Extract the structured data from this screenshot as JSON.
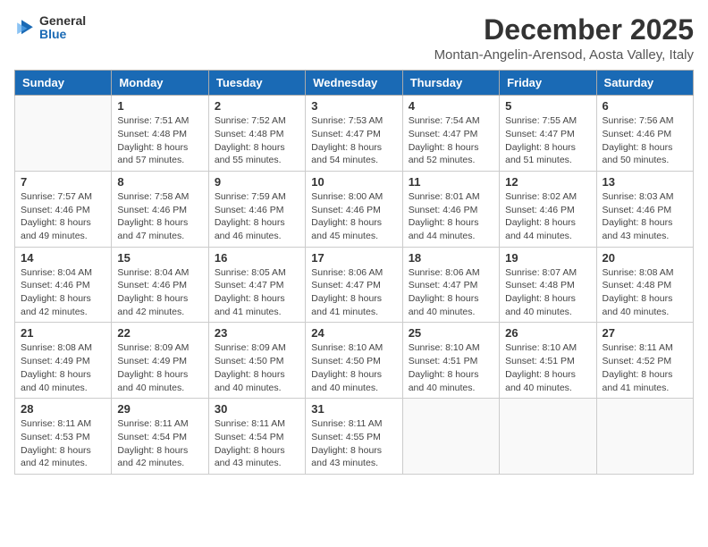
{
  "header": {
    "logo_general": "General",
    "logo_blue": "Blue",
    "month_title": "December 2025",
    "location": "Montan-Angelin-Arensod, Aosta Valley, Italy"
  },
  "days_of_week": [
    "Sunday",
    "Monday",
    "Tuesday",
    "Wednesday",
    "Thursday",
    "Friday",
    "Saturday"
  ],
  "weeks": [
    [
      {
        "day": "",
        "sunrise": "",
        "sunset": "",
        "daylight": ""
      },
      {
        "day": "1",
        "sunrise": "7:51 AM",
        "sunset": "4:48 PM",
        "daylight": "8 hours and 57 minutes."
      },
      {
        "day": "2",
        "sunrise": "7:52 AM",
        "sunset": "4:48 PM",
        "daylight": "8 hours and 55 minutes."
      },
      {
        "day": "3",
        "sunrise": "7:53 AM",
        "sunset": "4:47 PM",
        "daylight": "8 hours and 54 minutes."
      },
      {
        "day": "4",
        "sunrise": "7:54 AM",
        "sunset": "4:47 PM",
        "daylight": "8 hours and 52 minutes."
      },
      {
        "day": "5",
        "sunrise": "7:55 AM",
        "sunset": "4:47 PM",
        "daylight": "8 hours and 51 minutes."
      },
      {
        "day": "6",
        "sunrise": "7:56 AM",
        "sunset": "4:46 PM",
        "daylight": "8 hours and 50 minutes."
      }
    ],
    [
      {
        "day": "7",
        "sunrise": "7:57 AM",
        "sunset": "4:46 PM",
        "daylight": "8 hours and 49 minutes."
      },
      {
        "day": "8",
        "sunrise": "7:58 AM",
        "sunset": "4:46 PM",
        "daylight": "8 hours and 47 minutes."
      },
      {
        "day": "9",
        "sunrise": "7:59 AM",
        "sunset": "4:46 PM",
        "daylight": "8 hours and 46 minutes."
      },
      {
        "day": "10",
        "sunrise": "8:00 AM",
        "sunset": "4:46 PM",
        "daylight": "8 hours and 45 minutes."
      },
      {
        "day": "11",
        "sunrise": "8:01 AM",
        "sunset": "4:46 PM",
        "daylight": "8 hours and 44 minutes."
      },
      {
        "day": "12",
        "sunrise": "8:02 AM",
        "sunset": "4:46 PM",
        "daylight": "8 hours and 44 minutes."
      },
      {
        "day": "13",
        "sunrise": "8:03 AM",
        "sunset": "4:46 PM",
        "daylight": "8 hours and 43 minutes."
      }
    ],
    [
      {
        "day": "14",
        "sunrise": "8:04 AM",
        "sunset": "4:46 PM",
        "daylight": "8 hours and 42 minutes."
      },
      {
        "day": "15",
        "sunrise": "8:04 AM",
        "sunset": "4:46 PM",
        "daylight": "8 hours and 42 minutes."
      },
      {
        "day": "16",
        "sunrise": "8:05 AM",
        "sunset": "4:47 PM",
        "daylight": "8 hours and 41 minutes."
      },
      {
        "day": "17",
        "sunrise": "8:06 AM",
        "sunset": "4:47 PM",
        "daylight": "8 hours and 41 minutes."
      },
      {
        "day": "18",
        "sunrise": "8:06 AM",
        "sunset": "4:47 PM",
        "daylight": "8 hours and 40 minutes."
      },
      {
        "day": "19",
        "sunrise": "8:07 AM",
        "sunset": "4:48 PM",
        "daylight": "8 hours and 40 minutes."
      },
      {
        "day": "20",
        "sunrise": "8:08 AM",
        "sunset": "4:48 PM",
        "daylight": "8 hours and 40 minutes."
      }
    ],
    [
      {
        "day": "21",
        "sunrise": "8:08 AM",
        "sunset": "4:49 PM",
        "daylight": "8 hours and 40 minutes."
      },
      {
        "day": "22",
        "sunrise": "8:09 AM",
        "sunset": "4:49 PM",
        "daylight": "8 hours and 40 minutes."
      },
      {
        "day": "23",
        "sunrise": "8:09 AM",
        "sunset": "4:50 PM",
        "daylight": "8 hours and 40 minutes."
      },
      {
        "day": "24",
        "sunrise": "8:10 AM",
        "sunset": "4:50 PM",
        "daylight": "8 hours and 40 minutes."
      },
      {
        "day": "25",
        "sunrise": "8:10 AM",
        "sunset": "4:51 PM",
        "daylight": "8 hours and 40 minutes."
      },
      {
        "day": "26",
        "sunrise": "8:10 AM",
        "sunset": "4:51 PM",
        "daylight": "8 hours and 40 minutes."
      },
      {
        "day": "27",
        "sunrise": "8:11 AM",
        "sunset": "4:52 PM",
        "daylight": "8 hours and 41 minutes."
      }
    ],
    [
      {
        "day": "28",
        "sunrise": "8:11 AM",
        "sunset": "4:53 PM",
        "daylight": "8 hours and 42 minutes."
      },
      {
        "day": "29",
        "sunrise": "8:11 AM",
        "sunset": "4:54 PM",
        "daylight": "8 hours and 42 minutes."
      },
      {
        "day": "30",
        "sunrise": "8:11 AM",
        "sunset": "4:54 PM",
        "daylight": "8 hours and 43 minutes."
      },
      {
        "day": "31",
        "sunrise": "8:11 AM",
        "sunset": "4:55 PM",
        "daylight": "8 hours and 43 minutes."
      },
      {
        "day": "",
        "sunrise": "",
        "sunset": "",
        "daylight": ""
      },
      {
        "day": "",
        "sunrise": "",
        "sunset": "",
        "daylight": ""
      },
      {
        "day": "",
        "sunrise": "",
        "sunset": "",
        "daylight": ""
      }
    ]
  ]
}
